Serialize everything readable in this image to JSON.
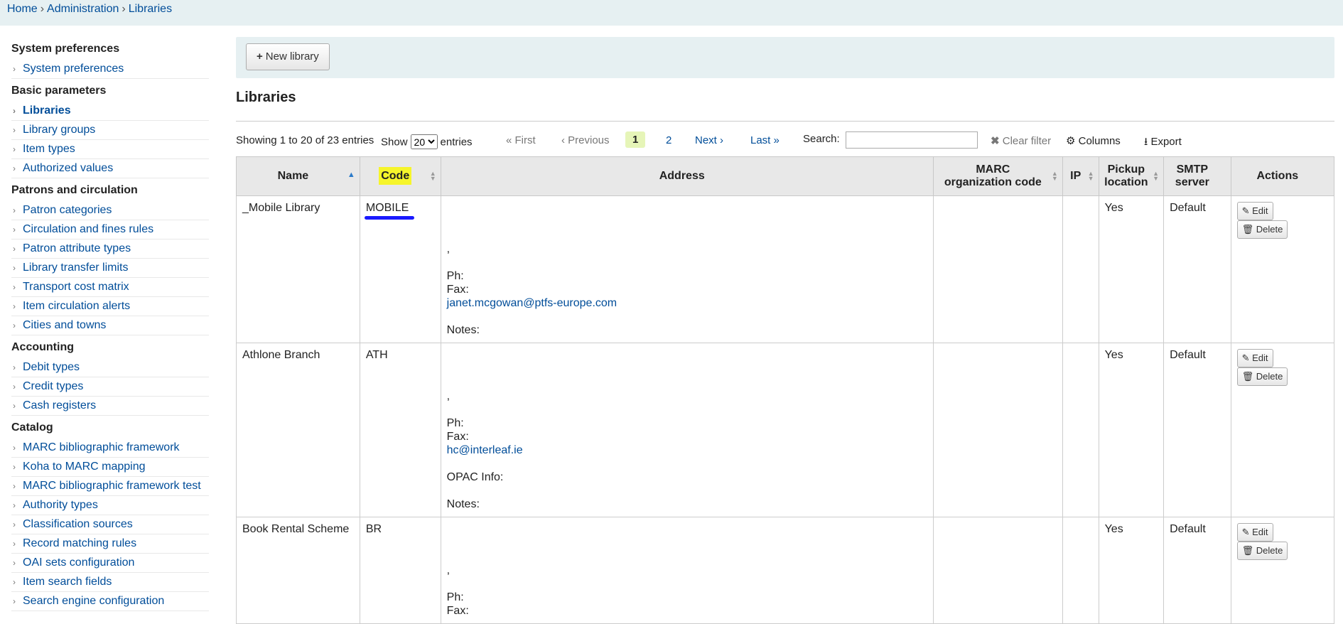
{
  "breadcrumb": {
    "home": "Home",
    "admin": "Administration",
    "current": "Libraries",
    "sep": "›"
  },
  "sidebar": {
    "sections": [
      {
        "heading": "System preferences",
        "items": [
          "System preferences"
        ]
      },
      {
        "heading": "Basic parameters",
        "items": [
          "Libraries",
          "Library groups",
          "Item types",
          "Authorized values"
        ]
      },
      {
        "heading": "Patrons and circulation",
        "items": [
          "Patron categories",
          "Circulation and fines rules",
          "Patron attribute types",
          "Library transfer limits",
          "Transport cost matrix",
          "Item circulation alerts",
          "Cities and towns"
        ]
      },
      {
        "heading": "Accounting",
        "items": [
          "Debit types",
          "Credit types",
          "Cash registers"
        ]
      },
      {
        "heading": "Catalog",
        "items": [
          "MARC bibliographic framework",
          "Koha to MARC mapping",
          "MARC bibliographic framework test",
          "Authority types",
          "Classification sources",
          "Record matching rules",
          "OAI sets configuration",
          "Item search fields",
          "Search engine configuration"
        ]
      }
    ],
    "current": "Libraries"
  },
  "toolbar": {
    "new_library": "New library"
  },
  "page_title": "Libraries",
  "controls": {
    "info": "Showing 1 to 20 of 23 entries",
    "show_label": "Show",
    "show_value": "20",
    "entries_label": "entries",
    "first": "« First",
    "previous": "‹ Previous",
    "page1": "1",
    "page2": "2",
    "next": "Next ›",
    "last": "Last »",
    "search_label": "Search:",
    "search_value": "",
    "clear_filter": "Clear filter",
    "columns": "Columns",
    "export": "Export"
  },
  "table": {
    "headers": {
      "name": "Name",
      "code": "Code",
      "address": "Address",
      "marc_org_1": "MARC",
      "marc_org_2": "organization code",
      "ip": "IP",
      "pickup_1": "Pickup",
      "pickup_2": "location",
      "smtp_1": "SMTP",
      "smtp_2": "server",
      "actions": "Actions"
    },
    "rows": [
      {
        "name": "_Mobile Library",
        "code": "MOBILE",
        "address": {
          "comma": ",",
          "ph": "Ph:",
          "fax": "Fax:",
          "email": "janet.mcgowan@ptfs-europe.com",
          "opac": "",
          "notes": "Notes:"
        },
        "marc": "",
        "ip": "",
        "pickup": "Yes",
        "smtp": "Default"
      },
      {
        "name": "Athlone Branch",
        "code": "ATH",
        "address": {
          "comma": ",",
          "ph": "Ph:",
          "fax": "Fax:",
          "email": "hc@interleaf.ie",
          "opac": "OPAC Info:",
          "notes": "Notes:"
        },
        "marc": "",
        "ip": "",
        "pickup": "Yes",
        "smtp": "Default"
      },
      {
        "name": "Book Rental Scheme",
        "code": "BR",
        "address": {
          "comma": ",",
          "ph": "Ph:",
          "fax": "Fax:",
          "email": "",
          "opac": "",
          "notes": ""
        },
        "marc": "",
        "ip": "",
        "pickup": "Yes",
        "smtp": "Default"
      }
    ],
    "edit_label": "Edit",
    "delete_label": "Delete"
  },
  "colors": {
    "accent": "#004d99",
    "highlight": "#f6f52b",
    "annotation": "#1a1aff",
    "toolbar_bg": "#e6f0f2"
  }
}
